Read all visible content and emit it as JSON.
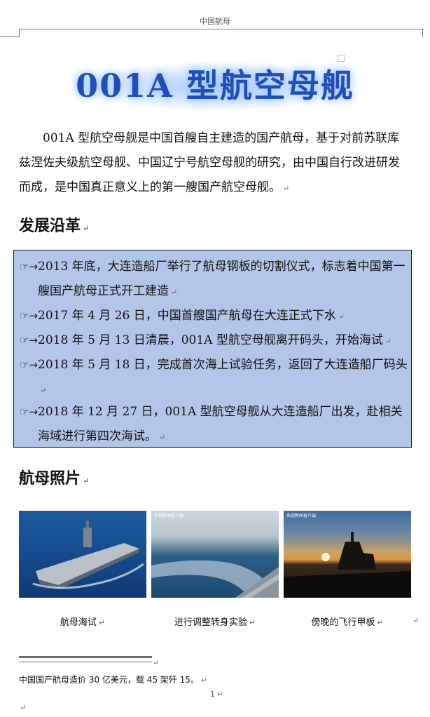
{
  "header": {
    "text": "中国航母"
  },
  "title": "001A 型航空母舰",
  "intro": "001A 型航空母舰是中国首艘自主建造的国产航母，基于对前苏联库兹涅佐夫级航空母舰、中国辽宁号航空母舰的研究，由中国自行改进研发而成，是中国真正意义上的第一艘国产航空母舰。",
  "sections": {
    "development": {
      "heading": "发展沿革",
      "items": [
        "2013 年底，大连造船厂举行了航母钢板的切割仪式，标志着中国第一艘国产航母正式开工建造",
        "2017 年 4 月 26 日，中国首艘国产航母在大连正式下水",
        "2018 年 5 月 13 日清晨，001A 型航空母舰离开码头，开始海试",
        "2018 年 5 月 18 日，完成首次海上试验任务，返回了大连造船厂码头",
        "2018 年 12 月 27 日，001A 型航空母舰从大连造船厂出发，赴相关海域进行第四次海试。"
      ]
    },
    "photos": {
      "heading": "航母照片",
      "captions": [
        "航母海试",
        "进行调整转身实验",
        "傍晚的飞行甲板"
      ],
      "watermarks": [
        "央视新闻客户端",
        "央视新闻客户端"
      ]
    }
  },
  "footnote": "中国国产航母造价 30 亿美元，载 45 架歼 15。",
  "page_number": "1",
  "icons": {
    "bullet": "pointing-hand-icon",
    "paragraph_mark": "↵"
  }
}
